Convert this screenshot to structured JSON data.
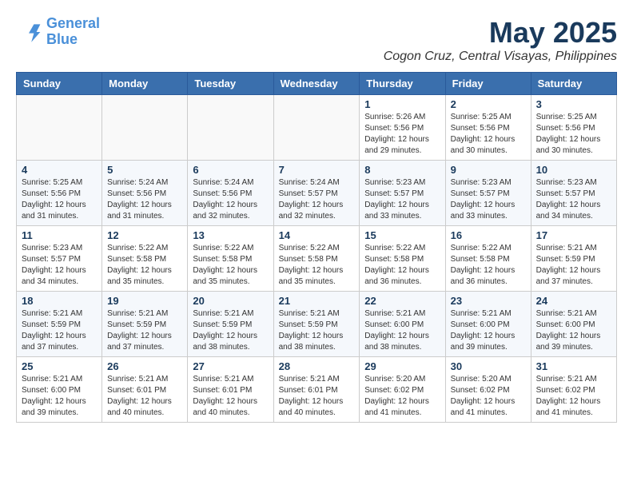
{
  "header": {
    "logo_line1": "General",
    "logo_line2": "Blue",
    "month": "May 2025",
    "location": "Cogon Cruz, Central Visayas, Philippines"
  },
  "weekdays": [
    "Sunday",
    "Monday",
    "Tuesday",
    "Wednesday",
    "Thursday",
    "Friday",
    "Saturday"
  ],
  "weeks": [
    [
      {
        "day": "",
        "info": ""
      },
      {
        "day": "",
        "info": ""
      },
      {
        "day": "",
        "info": ""
      },
      {
        "day": "",
        "info": ""
      },
      {
        "day": "1",
        "info": "Sunrise: 5:26 AM\nSunset: 5:56 PM\nDaylight: 12 hours\nand 29 minutes."
      },
      {
        "day": "2",
        "info": "Sunrise: 5:25 AM\nSunset: 5:56 PM\nDaylight: 12 hours\nand 30 minutes."
      },
      {
        "day": "3",
        "info": "Sunrise: 5:25 AM\nSunset: 5:56 PM\nDaylight: 12 hours\nand 30 minutes."
      }
    ],
    [
      {
        "day": "4",
        "info": "Sunrise: 5:25 AM\nSunset: 5:56 PM\nDaylight: 12 hours\nand 31 minutes."
      },
      {
        "day": "5",
        "info": "Sunrise: 5:24 AM\nSunset: 5:56 PM\nDaylight: 12 hours\nand 31 minutes."
      },
      {
        "day": "6",
        "info": "Sunrise: 5:24 AM\nSunset: 5:56 PM\nDaylight: 12 hours\nand 32 minutes."
      },
      {
        "day": "7",
        "info": "Sunrise: 5:24 AM\nSunset: 5:57 PM\nDaylight: 12 hours\nand 32 minutes."
      },
      {
        "day": "8",
        "info": "Sunrise: 5:23 AM\nSunset: 5:57 PM\nDaylight: 12 hours\nand 33 minutes."
      },
      {
        "day": "9",
        "info": "Sunrise: 5:23 AM\nSunset: 5:57 PM\nDaylight: 12 hours\nand 33 minutes."
      },
      {
        "day": "10",
        "info": "Sunrise: 5:23 AM\nSunset: 5:57 PM\nDaylight: 12 hours\nand 34 minutes."
      }
    ],
    [
      {
        "day": "11",
        "info": "Sunrise: 5:23 AM\nSunset: 5:57 PM\nDaylight: 12 hours\nand 34 minutes."
      },
      {
        "day": "12",
        "info": "Sunrise: 5:22 AM\nSunset: 5:58 PM\nDaylight: 12 hours\nand 35 minutes."
      },
      {
        "day": "13",
        "info": "Sunrise: 5:22 AM\nSunset: 5:58 PM\nDaylight: 12 hours\nand 35 minutes."
      },
      {
        "day": "14",
        "info": "Sunrise: 5:22 AM\nSunset: 5:58 PM\nDaylight: 12 hours\nand 35 minutes."
      },
      {
        "day": "15",
        "info": "Sunrise: 5:22 AM\nSunset: 5:58 PM\nDaylight: 12 hours\nand 36 minutes."
      },
      {
        "day": "16",
        "info": "Sunrise: 5:22 AM\nSunset: 5:58 PM\nDaylight: 12 hours\nand 36 minutes."
      },
      {
        "day": "17",
        "info": "Sunrise: 5:21 AM\nSunset: 5:59 PM\nDaylight: 12 hours\nand 37 minutes."
      }
    ],
    [
      {
        "day": "18",
        "info": "Sunrise: 5:21 AM\nSunset: 5:59 PM\nDaylight: 12 hours\nand 37 minutes."
      },
      {
        "day": "19",
        "info": "Sunrise: 5:21 AM\nSunset: 5:59 PM\nDaylight: 12 hours\nand 37 minutes."
      },
      {
        "day": "20",
        "info": "Sunrise: 5:21 AM\nSunset: 5:59 PM\nDaylight: 12 hours\nand 38 minutes."
      },
      {
        "day": "21",
        "info": "Sunrise: 5:21 AM\nSunset: 5:59 PM\nDaylight: 12 hours\nand 38 minutes."
      },
      {
        "day": "22",
        "info": "Sunrise: 5:21 AM\nSunset: 6:00 PM\nDaylight: 12 hours\nand 38 minutes."
      },
      {
        "day": "23",
        "info": "Sunrise: 5:21 AM\nSunset: 6:00 PM\nDaylight: 12 hours\nand 39 minutes."
      },
      {
        "day": "24",
        "info": "Sunrise: 5:21 AM\nSunset: 6:00 PM\nDaylight: 12 hours\nand 39 minutes."
      }
    ],
    [
      {
        "day": "25",
        "info": "Sunrise: 5:21 AM\nSunset: 6:00 PM\nDaylight: 12 hours\nand 39 minutes."
      },
      {
        "day": "26",
        "info": "Sunrise: 5:21 AM\nSunset: 6:01 PM\nDaylight: 12 hours\nand 40 minutes."
      },
      {
        "day": "27",
        "info": "Sunrise: 5:21 AM\nSunset: 6:01 PM\nDaylight: 12 hours\nand 40 minutes."
      },
      {
        "day": "28",
        "info": "Sunrise: 5:21 AM\nSunset: 6:01 PM\nDaylight: 12 hours\nand 40 minutes."
      },
      {
        "day": "29",
        "info": "Sunrise: 5:20 AM\nSunset: 6:02 PM\nDaylight: 12 hours\nand 41 minutes."
      },
      {
        "day": "30",
        "info": "Sunrise: 5:20 AM\nSunset: 6:02 PM\nDaylight: 12 hours\nand 41 minutes."
      },
      {
        "day": "31",
        "info": "Sunrise: 5:21 AM\nSunset: 6:02 PM\nDaylight: 12 hours\nand 41 minutes."
      }
    ]
  ]
}
